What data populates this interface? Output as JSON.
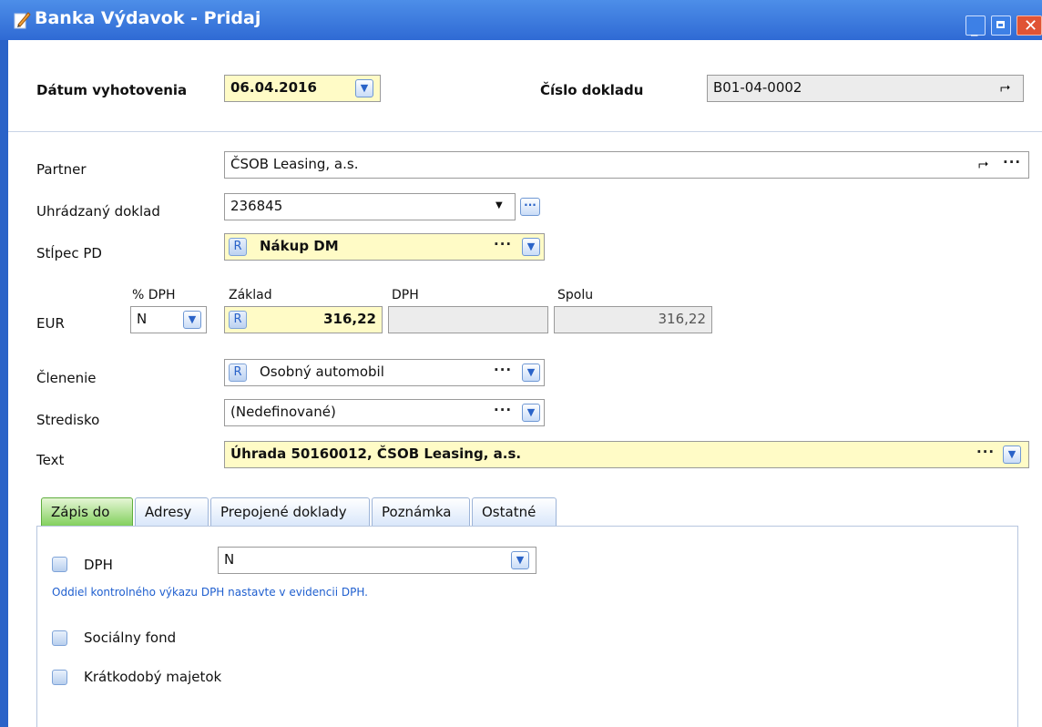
{
  "window": {
    "title": "Banka Výdavok - Pridaj"
  },
  "header": {
    "date_label": "Dátum vyhotovenia",
    "date_value": "06.04.2016",
    "doc_label": "Číslo dokladu",
    "doc_value": "B01-04-0002"
  },
  "form": {
    "partner_label": "Partner",
    "partner_value": "ČSOB Leasing, a.s.",
    "uhradzany_label": "Uhrádzaný doklad",
    "uhradzany_value": "236845",
    "stlpec_label": "Stĺpec PD",
    "stlpec_badge": "R",
    "stlpec_value": "Nákup DM",
    "eur_label": "EUR",
    "dph_pct_label": "% DPH",
    "dph_pct_value": "N",
    "zaklad_label": "Základ",
    "zaklad_badge": "R",
    "zaklad_value": "316,22",
    "dph_label": "DPH",
    "dph_value": "",
    "spolu_label": "Spolu",
    "spolu_value": "316,22",
    "clenenie_label": "Členenie",
    "clenenie_badge": "R",
    "clenenie_value": "Osobný automobil",
    "stredisko_label": "Stredisko",
    "stredisko_value": "(Nedefinované)",
    "text_label": "Text",
    "text_value": "Úhrada 50160012, ČSOB Leasing, a.s."
  },
  "tabs": [
    {
      "label": "Zápis do"
    },
    {
      "label": "Adresy"
    },
    {
      "label": "Prepojené doklady"
    },
    {
      "label": "Poznámka"
    },
    {
      "label": "Ostatné"
    }
  ],
  "panel": {
    "dph_check_label": "DPH",
    "dph_select_value": "N",
    "info_text": "Oddiel kontrolného výkazu DPH nastavte v evidencii DPH.",
    "socialny_label": "Sociálny fond",
    "kratkodoby_label": "Krátkodobý majetok"
  },
  "colors": {
    "titlebar": "#2f6ad4",
    "highlight_field": "#fffbc6",
    "active_tab": "#7fcf5a",
    "info_text": "#1f5fcf"
  }
}
